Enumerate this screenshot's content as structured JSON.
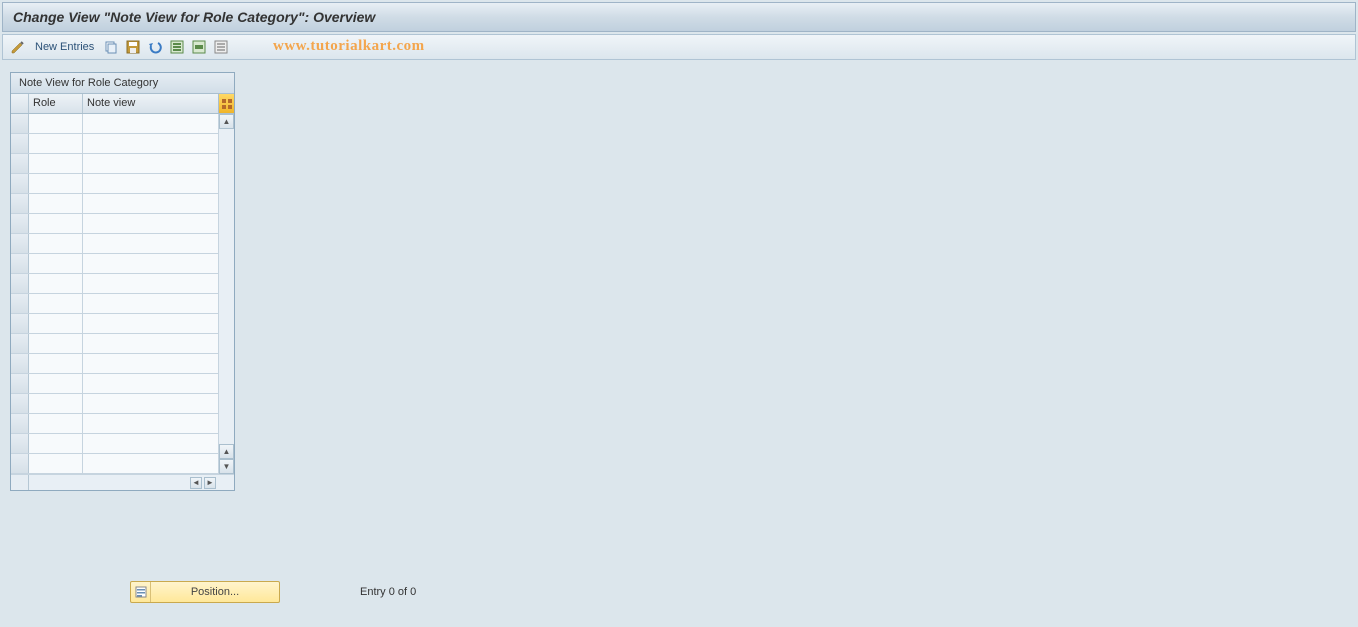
{
  "title": "Change View \"Note View for Role Category\": Overview",
  "toolbar": {
    "new_entries_label": "New Entries"
  },
  "watermark": "www.tutorialkart.com",
  "table": {
    "title": "Note View for Role Category",
    "columns": {
      "role": "Role",
      "note_view": "Note view"
    },
    "rows": [
      {
        "role": "",
        "note_view": ""
      },
      {
        "role": "",
        "note_view": ""
      },
      {
        "role": "",
        "note_view": ""
      },
      {
        "role": "",
        "note_view": ""
      },
      {
        "role": "",
        "note_view": ""
      },
      {
        "role": "",
        "note_view": ""
      },
      {
        "role": "",
        "note_view": ""
      },
      {
        "role": "",
        "note_view": ""
      },
      {
        "role": "",
        "note_view": ""
      },
      {
        "role": "",
        "note_view": ""
      },
      {
        "role": "",
        "note_view": ""
      },
      {
        "role": "",
        "note_view": ""
      },
      {
        "role": "",
        "note_view": ""
      },
      {
        "role": "",
        "note_view": ""
      },
      {
        "role": "",
        "note_view": ""
      },
      {
        "role": "",
        "note_view": ""
      },
      {
        "role": "",
        "note_view": ""
      },
      {
        "role": "",
        "note_view": ""
      }
    ]
  },
  "footer": {
    "position_label": "Position...",
    "entry_text": "Entry 0 of 0"
  }
}
